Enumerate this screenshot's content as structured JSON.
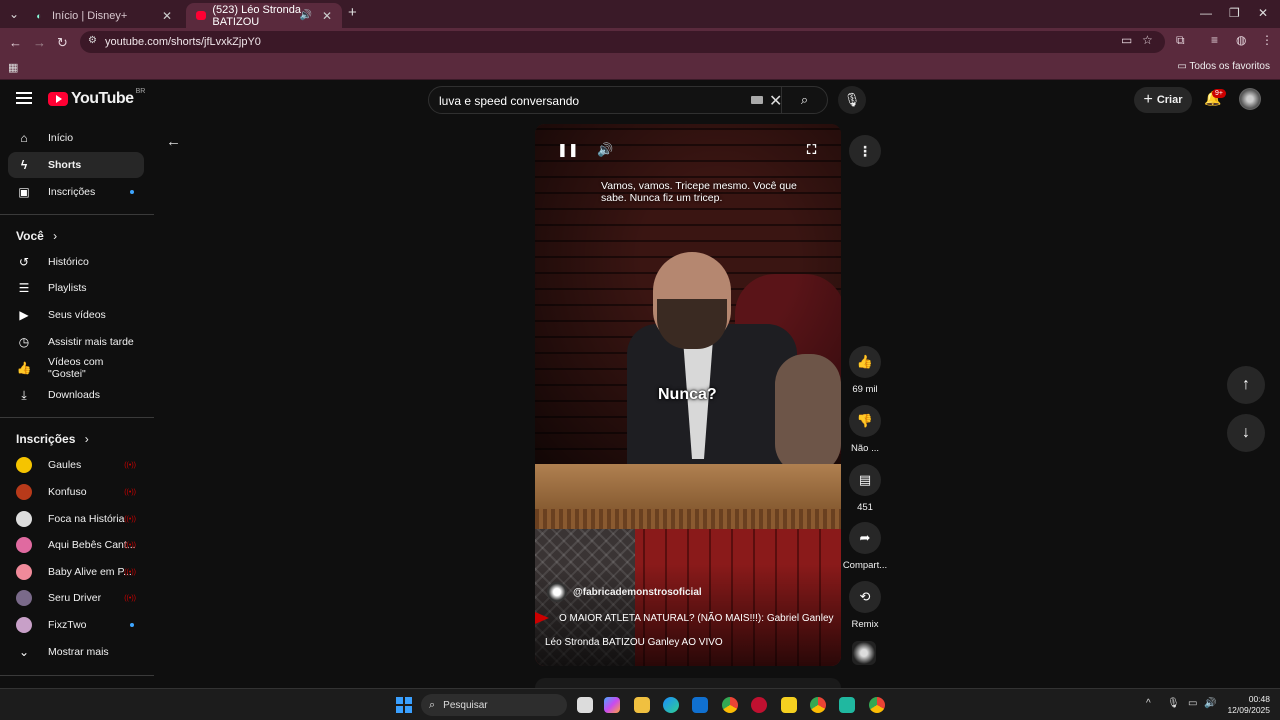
{
  "browser": {
    "tabs": [
      {
        "title": "Início | Disney+"
      },
      {
        "title": "(523) Léo Stronda BATIZOU"
      }
    ],
    "url": "youtube.com/shorts/jfLvxkZjpY0",
    "bookmarks_all": "Todos os favoritos"
  },
  "header": {
    "logo": "YouTube",
    "region": "BR",
    "search_query": "luva e speed conversando",
    "create_label": "Criar",
    "notifications_badge": "9+"
  },
  "sidebar": {
    "main": [
      {
        "label": "Início"
      },
      {
        "label": "Shorts"
      },
      {
        "label": "Inscrições"
      }
    ],
    "you_header": "Você",
    "you": [
      {
        "label": "Histórico"
      },
      {
        "label": "Playlists"
      },
      {
        "label": "Seus vídeos"
      },
      {
        "label": "Assistir mais tarde"
      },
      {
        "label": "Vídeos com \"Gostei\""
      },
      {
        "label": "Downloads"
      }
    ],
    "subs_header": "Inscrições",
    "subscriptions": [
      {
        "label": "Gaules",
        "color": "#f5c400"
      },
      {
        "label": "Konfuso",
        "color": "#b83a1a"
      },
      {
        "label": "Foca na História",
        "color": "#dddddd"
      },
      {
        "label": "Aqui Bebês Cant...",
        "color": "#e06aa0"
      },
      {
        "label": "Baby Alive em P...",
        "color": "#f08a9a"
      },
      {
        "label": "Seru Driver",
        "color": "#7a6a8a"
      },
      {
        "label": "FixzTwo",
        "color": "#c8a0c8"
      }
    ],
    "show_more": "Mostrar mais"
  },
  "video": {
    "caption": "Vamos, vamos. Tricepe mesmo. Você que sabe. Nunca fiz um tricep.",
    "subtitle": "Nunca?",
    "channel": "@fabricademonstrosoficial",
    "related": "O MAIOR ATLETA NATURAL? (NÃO MAIS!!!): Gabriel Ganley",
    "title": "Léo Stronda BATIZOU Ganley AO VIVO"
  },
  "actions": {
    "likes": "69 mil",
    "dislike": "Não ...",
    "comments": "451",
    "share": "Compart...",
    "remix": "Remix"
  },
  "taskbar": {
    "search": "Pesquisar",
    "time": "00:48",
    "date": "12/09/2025"
  }
}
